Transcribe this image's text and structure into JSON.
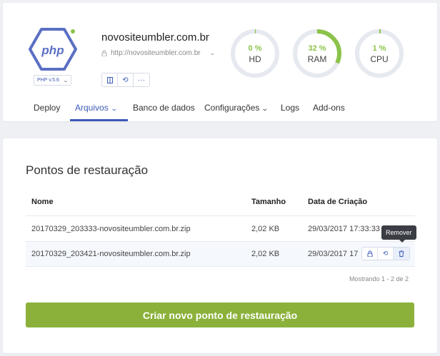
{
  "site": {
    "name": "novositeumbler.com.br",
    "url": "http://novositeumbler.com.br",
    "php_version": "PHP v.5.6",
    "logo_text": "php"
  },
  "gauges": [
    {
      "value": "0 %",
      "label": "HD",
      "percent": 0
    },
    {
      "value": "32 %",
      "label": "RAM",
      "percent": 32
    },
    {
      "value": "1 %",
      "label": "CPU",
      "percent": 1
    }
  ],
  "tabs": [
    {
      "label": "Deploy",
      "active": false
    },
    {
      "label": "Arquivos",
      "active": true
    },
    {
      "label": "Banco de dados",
      "active": false
    },
    {
      "label": "Configurações",
      "active": false
    },
    {
      "label": "Logs",
      "active": false
    },
    {
      "label": "Add-ons",
      "active": false
    }
  ],
  "restore": {
    "title": "Pontos de restauração",
    "columns": [
      "Nome",
      "Tamanho",
      "Data de Criação"
    ],
    "rows": [
      {
        "name": "20170329_203333-novositeumbler.com.br.zip",
        "size": "2,02 KB",
        "date": "29/03/2017 17:33:33"
      },
      {
        "name": "20170329_203421-novositeumbler.com.br.zip",
        "size": "2,02 KB",
        "date": "29/03/2017 17:34:21"
      }
    ],
    "tooltip": "Remover",
    "pagination": "Mostrando 1 - 2 de 2",
    "create_button": "Criar novo ponto de restauração"
  },
  "colors": {
    "accent": "#3b5ab8",
    "green": "#8bc34a",
    "button_green": "#8bb13a"
  },
  "icons": {
    "lock": "lock-icon",
    "columns": "columns-icon",
    "restart": "restart-icon",
    "more": "more-icon",
    "lock_file": "lock-icon",
    "restore": "restore-icon",
    "delete": "trash-icon"
  }
}
